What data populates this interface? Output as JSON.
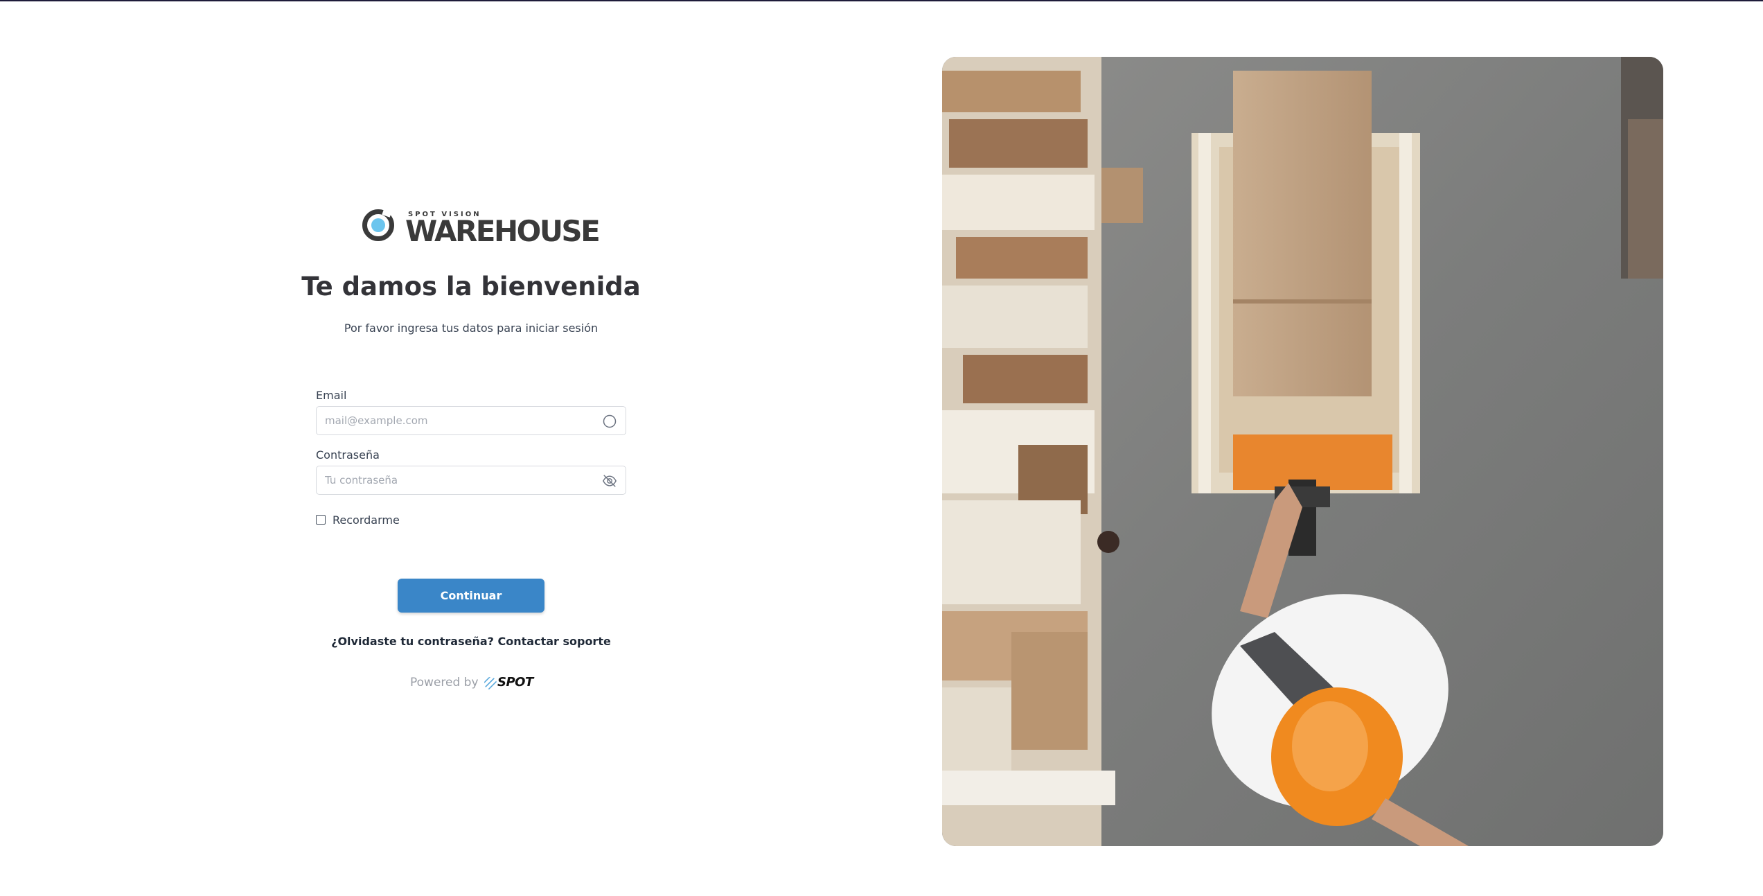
{
  "logo": {
    "small_text": "SPOT VISION",
    "big_text": "WAREHOUSE",
    "accent_color": "#6cc5ee"
  },
  "heading": {
    "title": "Te damos la bienvenida",
    "subtitle": "Por favor ingresa tus datos para iniciar sesión"
  },
  "form": {
    "email_label": "Email",
    "email_value": "",
    "email_placeholder": "mail@example.com",
    "email_icon": "circle-icon",
    "password_label": "Contraseña",
    "password_value": "",
    "password_placeholder": "Tu contraseña",
    "password_icon": "eye-off-icon",
    "remember_label": "Recordarme",
    "remember_checked": false,
    "submit_label": "Continuar",
    "button_color": "#3a86c8"
  },
  "links": {
    "forgot_label": "¿Olvidaste tu contraseña? Contactar soporte"
  },
  "footer": {
    "powered_label": "Powered by",
    "brand_name": "SPOT"
  },
  "hero_image": {
    "description_icon": "warehouse-worker-photo"
  }
}
